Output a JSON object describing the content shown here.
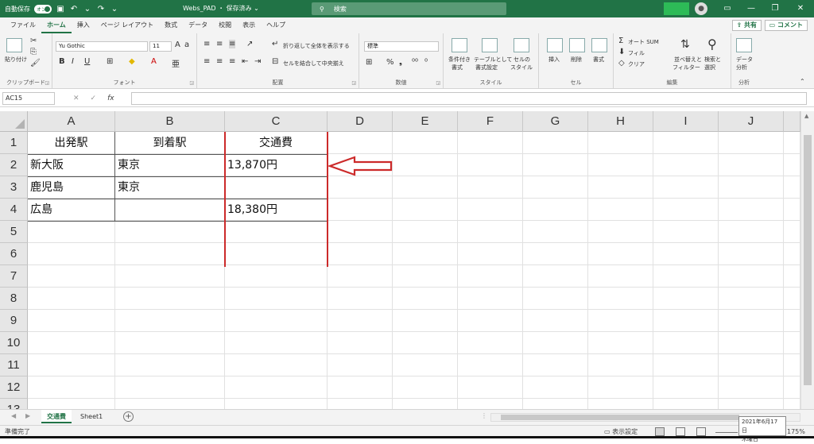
{
  "titlebar": {
    "autosave_label": "自動保存",
    "autosave_state": "オン",
    "filename": "Webs_PAD ・ 保存済み ⌄",
    "search_placeholder": "検索"
  },
  "menu": {
    "tabs": [
      "ファイル",
      "ホーム",
      "挿入",
      "ページ レイアウト",
      "数式",
      "データ",
      "校閲",
      "表示",
      "ヘルプ"
    ],
    "share": "共有",
    "comment": "コメント"
  },
  "ribbon": {
    "clipboard": {
      "label": "クリップボード",
      "paste": "貼り付け"
    },
    "font": {
      "label": "フォント",
      "name": "Yu Gothic",
      "size": "11"
    },
    "alignment": {
      "label": "配置",
      "wrap": "折り返して全体を表示する",
      "merge": "セルを結合して中央揃え"
    },
    "number": {
      "label": "数値",
      "format": "標準"
    },
    "styles": {
      "label": "スタイル",
      "cond1": "条件付き",
      "cond2": "書式",
      "table1": "テーブルとして",
      "table2": "書式設定",
      "cell1": "セルの",
      "cell2": "スタイル"
    },
    "cells": {
      "label": "セル",
      "insert": "挿入",
      "delete": "削除",
      "format": "書式"
    },
    "editing": {
      "label": "編集",
      "autosum": "オート SUM",
      "fill": "フィル",
      "clear": "クリア",
      "sort1": "並べ替えと",
      "sort2": "フィルター",
      "find1": "検索と",
      "find2": "選択"
    },
    "analysis": {
      "label": "分析",
      "data1": "データ",
      "data2": "分析"
    }
  },
  "formula_bar": {
    "name_box": "AC15",
    "fx": "fx",
    "formula": ""
  },
  "sheet": {
    "columns": [
      "A",
      "B",
      "C",
      "D",
      "E",
      "F",
      "G",
      "H",
      "I",
      "J"
    ],
    "rows": [
      "1",
      "2",
      "3",
      "4",
      "5",
      "6",
      "7",
      "8",
      "9",
      "10",
      "11",
      "12",
      "13"
    ],
    "cells": {
      "A1": "出発駅",
      "B1": "到着駅",
      "C1": "交通費",
      "A2": "新大阪",
      "B2": "東京",
      "C2": "13,870円",
      "A3": "鹿児島",
      "B3": "東京",
      "A4": "広島",
      "C4": "18,380円"
    }
  },
  "sheet_tabs": [
    "交通費",
    "Sheet1"
  ],
  "status": {
    "ready": "準備完了",
    "display_settings": "表示設定",
    "zoom": "175%",
    "tooltip_date": "2021年6月17日",
    "tooltip_day": "木曜日"
  },
  "colors": {
    "accent": "#217346",
    "annotation": "#cc2a2a"
  }
}
